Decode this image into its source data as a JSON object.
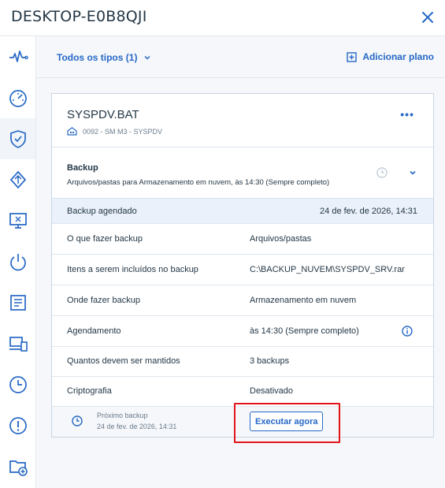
{
  "window": {
    "title": "DESKTOP-E0B8QJI"
  },
  "sidebar": {
    "items": [
      {
        "icon": "activity-icon"
      },
      {
        "icon": "dashboard-icon"
      },
      {
        "icon": "shield-icon",
        "active": true
      },
      {
        "icon": "backup-icon"
      },
      {
        "icon": "remote-desktop-icon"
      },
      {
        "icon": "power-icon"
      },
      {
        "icon": "report-icon"
      },
      {
        "icon": "devices-icon"
      },
      {
        "icon": "history-icon"
      },
      {
        "icon": "alert-icon"
      },
      {
        "icon": "folder-add-icon"
      }
    ]
  },
  "toolbar": {
    "filter_label": "Todos os tipos (1)",
    "add_plan_label": "Adicionar plano"
  },
  "device": {
    "name": "SYSPDV.BAT",
    "subtitle": "0092 - SM M3 - SYSPDV"
  },
  "plan": {
    "name": "Backup",
    "description": "Arquivos/pastas para Armazenamento em nuvem, às 14:30 (Sempre completo)"
  },
  "scheduled": {
    "label": "Backup agendado",
    "value": "24 de fev. de 2026, 14:31"
  },
  "details": [
    {
      "key": "O que fazer backup",
      "value": "Arquivos/pastas"
    },
    {
      "key": "Itens a serem incluídos no backup",
      "value": "C:\\BACKUP_NUVEM\\SYSPDV_SRV.rar"
    },
    {
      "key": "Onde fazer backup",
      "value": "Armazenamento em nuvem"
    },
    {
      "key": "Agendamento",
      "value": "às 14:30 (Sempre completo)"
    },
    {
      "key": "Quantos devem ser mantidos",
      "value": "3 backups"
    },
    {
      "key": "Criptografia",
      "value": "Desativado"
    }
  ],
  "footer": {
    "next_label": "Próximo backup",
    "next_time": "24 de fev. de 2026, 14:31",
    "run_now_label": "Executar agora"
  },
  "colors": {
    "accent": "#2668c5",
    "highlight": "#e2141a"
  }
}
